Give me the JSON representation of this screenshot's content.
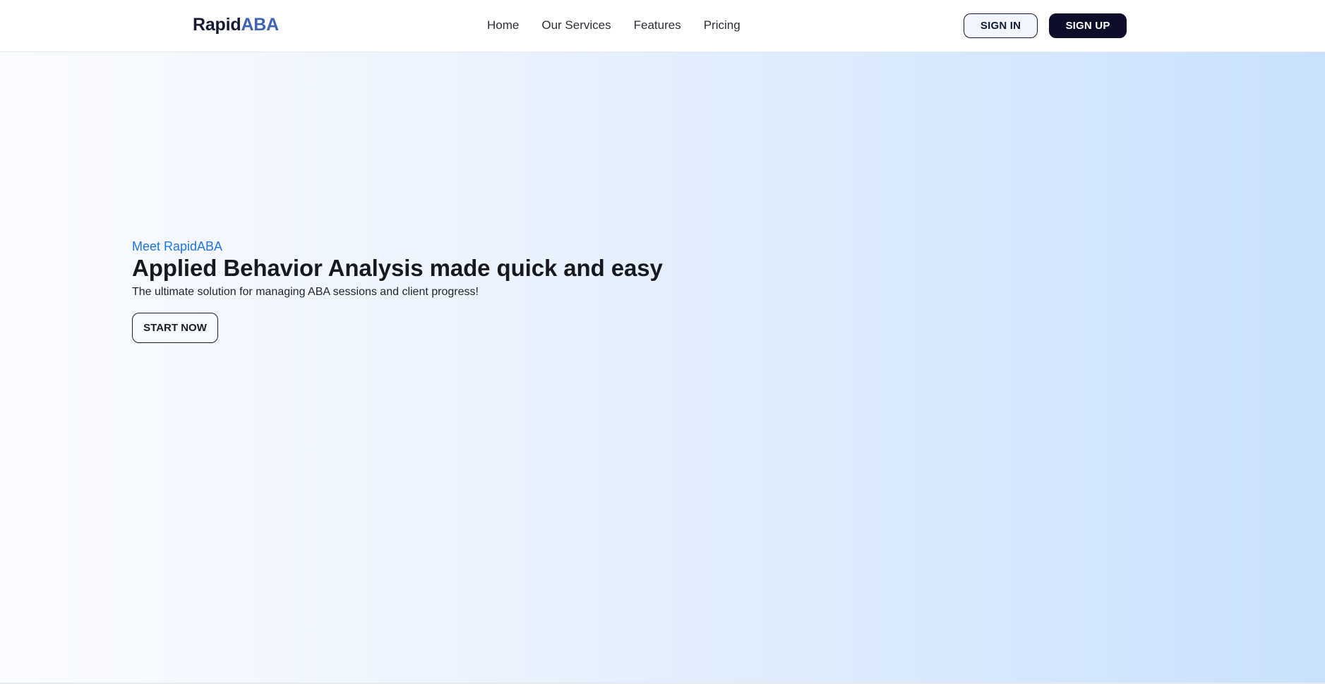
{
  "header": {
    "logo": {
      "part1": "Rapid",
      "part2": "ABA"
    },
    "nav": [
      {
        "label": "Home"
      },
      {
        "label": "Our Services"
      },
      {
        "label": "Features"
      },
      {
        "label": "Pricing"
      }
    ],
    "sign_in_label": "SIGN IN",
    "sign_up_label": "SIGN UP"
  },
  "hero": {
    "eyebrow": "Meet RapidABA",
    "headline": "Applied Behavior Analysis made quick and easy",
    "subtext": "The ultimate solution for managing ABA sessions and client progress!",
    "cta_label": "START NOW"
  },
  "colors": {
    "brand_dark": "#141a33",
    "brand_blue": "#3f63b3",
    "eyebrow_blue": "#1f75e0",
    "signup_bg": "#0e0e2b",
    "hero_gradient_start": "#fbfcff",
    "hero_gradient_end": "#c9e1fd"
  }
}
